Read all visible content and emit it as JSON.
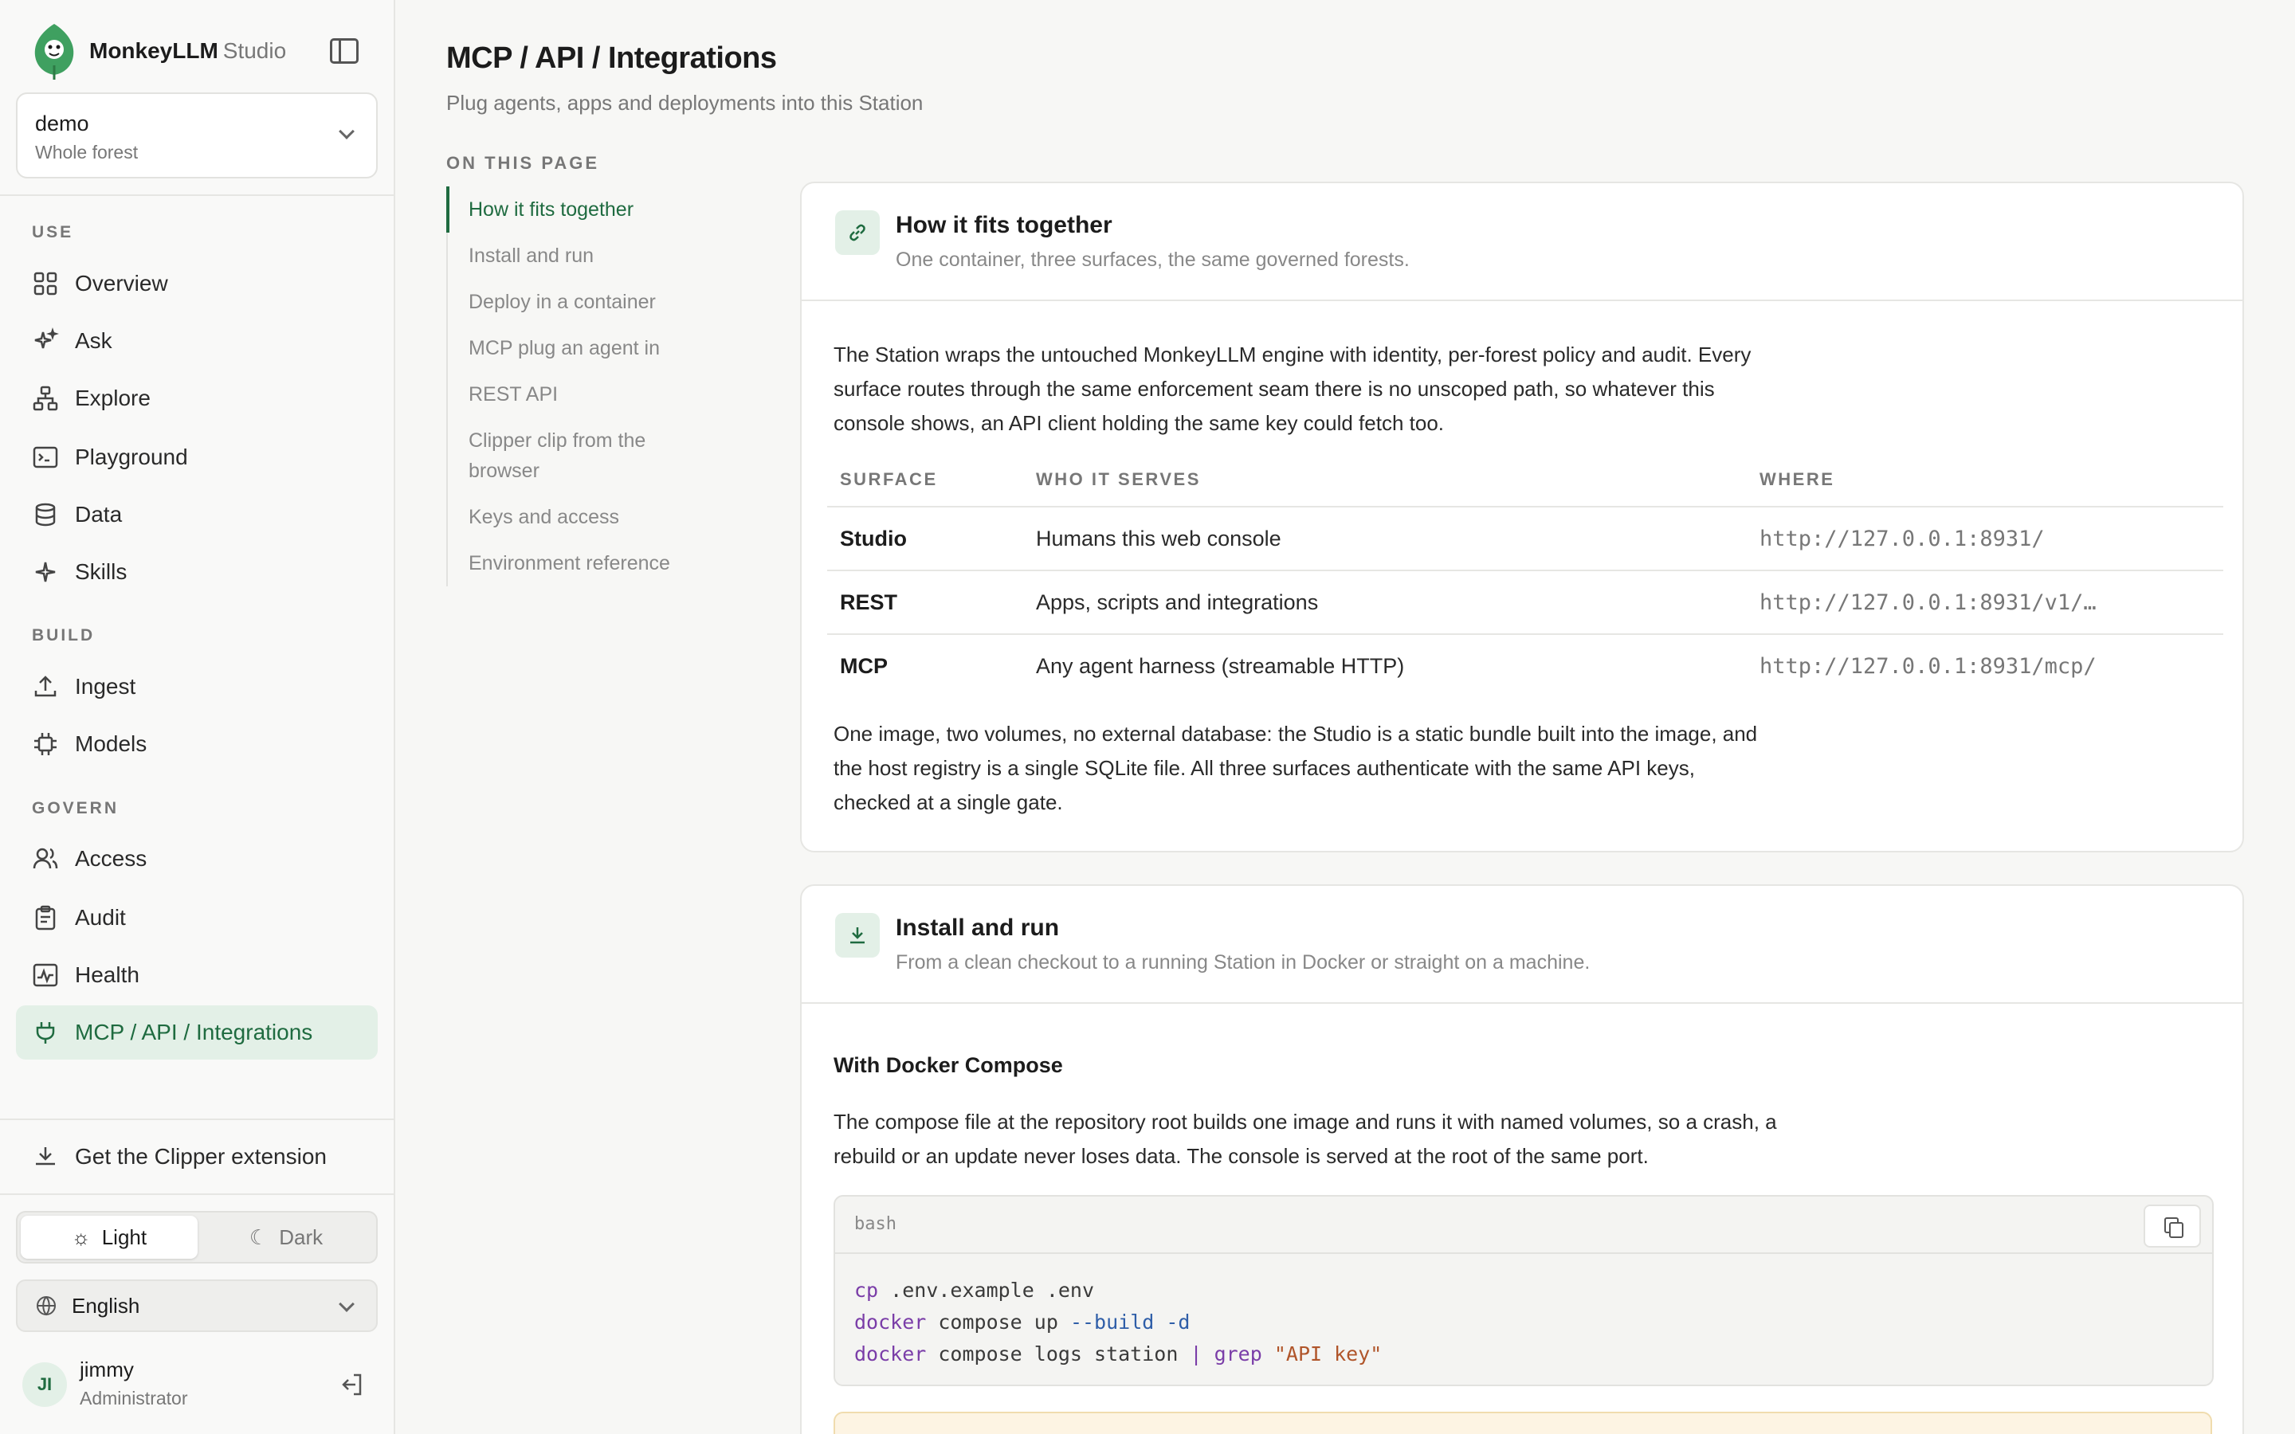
{
  "app": {
    "name": "MonkeyLLM",
    "suffix": "Studio"
  },
  "workspace": {
    "name": "demo",
    "scope": "Whole forest"
  },
  "nav": {
    "use_label": "USE",
    "use": [
      {
        "label": "Overview",
        "icon": "grid-icon"
      },
      {
        "label": "Ask",
        "icon": "sparkles-icon"
      },
      {
        "label": "Explore",
        "icon": "sitemap-icon"
      },
      {
        "label": "Playground",
        "icon": "terminal-icon"
      },
      {
        "label": "Data",
        "icon": "database-icon"
      },
      {
        "label": "Skills",
        "icon": "sparkle-icon"
      }
    ],
    "build_label": "BUILD",
    "build": [
      {
        "label": "Ingest",
        "icon": "upload-icon"
      },
      {
        "label": "Models",
        "icon": "chip-icon"
      }
    ],
    "govern_label": "GOVERN",
    "govern": [
      {
        "label": "Access",
        "icon": "users-icon"
      },
      {
        "label": "Audit",
        "icon": "clipboard-icon"
      },
      {
        "label": "Health",
        "icon": "activity-icon"
      },
      {
        "label": "MCP / API / Integrations",
        "icon": "plug-icon",
        "active": true
      }
    ]
  },
  "clipper_label": "Get the Clipper extension",
  "theme": {
    "light": "Light",
    "dark": "Dark",
    "selected": "Light"
  },
  "language": "English",
  "user": {
    "initials": "JI",
    "name": "jimmy",
    "role": "Administrator"
  },
  "page": {
    "title": "MCP / API / Integrations",
    "subtitle": "Plug agents, apps and deployments into this Station"
  },
  "toc": {
    "title": "ON THIS PAGE",
    "items": [
      "How it fits together",
      "Install and run",
      "Deploy in a container",
      "MCP plug an agent in",
      "REST API",
      "Clipper clip from the browser",
      "Keys and access",
      "Environment reference"
    ]
  },
  "fits": {
    "title": "How it fits together",
    "subtitle": "One container, three surfaces, the same governed forests.",
    "intro": "The Station wraps the untouched MonkeyLLM engine with identity, per-forest policy and audit. Every surface routes through the same enforcement seam there is no unscoped path, so whatever this console shows, an API client holding the same key could fetch too.",
    "table": {
      "headers": [
        "SURFACE",
        "WHO IT SERVES",
        "WHERE"
      ],
      "rows": [
        {
          "surface": "Studio",
          "serves": "Humans this web console",
          "where": "http://127.0.0.1:8931/"
        },
        {
          "surface": "REST",
          "serves": "Apps, scripts and integrations",
          "where": "http://127.0.0.1:8931/v1/…"
        },
        {
          "surface": "MCP",
          "serves": "Any agent harness (streamable HTTP)",
          "where": "http://127.0.0.1:8931/mcp/"
        }
      ]
    },
    "outro": "One image, two volumes, no external database: the Studio is a static bundle built into the image, and the host registry is a single SQLite file. All three surfaces authenticate with the same API keys, checked at a single gate."
  },
  "install": {
    "title": "Install and run",
    "subtitle": "From a clean checkout to a running Station in Docker or straight on a machine.",
    "compose_heading": "With Docker Compose",
    "compose_text": "The compose file at the repository root builds one image and runs it with named volumes, so a crash, a rebuild or an update never loses data. The console is served at the root of the same port.",
    "code": {
      "lang": "bash",
      "lines": [
        [
          "cp",
          " .env.example .env"
        ],
        [
          "docker",
          " compose up ",
          "--build -d"
        ],
        [
          "docker",
          " compose logs station ",
          "|",
          " ",
          "grep",
          " ",
          "\"API key\""
        ]
      ]
    }
  },
  "colors": {
    "accent": "#1f6b40",
    "accent_bg": "#e3f0e7"
  }
}
